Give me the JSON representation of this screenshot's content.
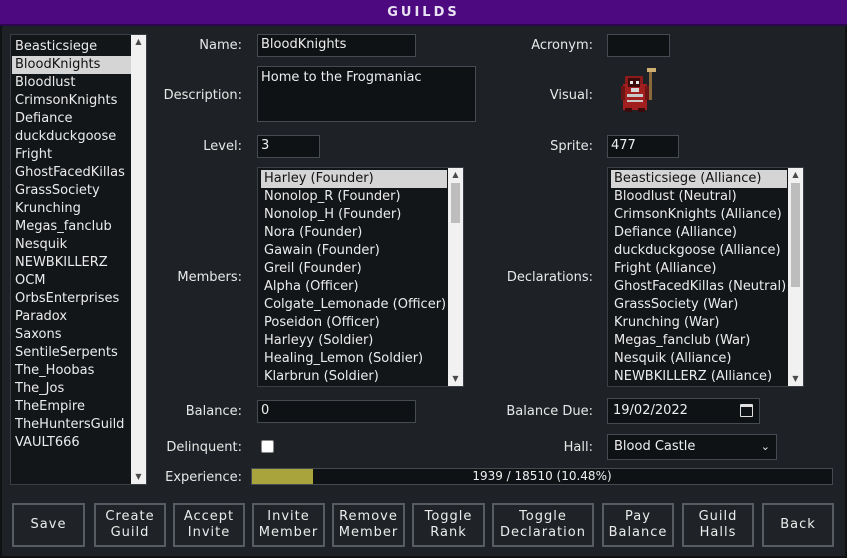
{
  "window": {
    "title": "GUILDS"
  },
  "guild_list": {
    "items": [
      "Beasticsiege",
      "BloodKnights",
      "Bloodlust",
      "CrimsonKnights",
      "Defiance",
      "duckduckgoose",
      "Fright",
      "GhostFacedKillas",
      "GrassSociety",
      "Krunching",
      "Megas_fanclub",
      "Nesquik",
      "NEWBKILLERZ",
      "OCM",
      "OrbsEnterprises",
      "Paradox",
      "Saxons",
      "SentileSerpents",
      "The_Hoobas",
      "The_Jos",
      "TheEmpire",
      "TheHuntersGuild",
      "VAULT666"
    ],
    "selected_index": 1
  },
  "form": {
    "name_label": "Name:",
    "name_value": "BloodKnights",
    "acronym_label": "Acronym:",
    "acronym_value": "",
    "description_label": "Description:",
    "description_value": "Home to the Frogmaniac",
    "visual_label": "Visual:",
    "level_label": "Level:",
    "level_value": "3",
    "sprite_label": "Sprite:",
    "sprite_value": "477",
    "members_label": "Members:",
    "declarations_label": "Declarations:",
    "balance_label": "Balance:",
    "balance_value": "0",
    "balance_due_label": "Balance Due:",
    "balance_due_value": "19/02/2022",
    "delinquent_label": "Delinquent:",
    "delinquent_checked": false,
    "hall_label": "Hall:",
    "hall_value": "Blood Castle",
    "experience_label": "Experience:",
    "experience_text": "1939 / 18510 (10.48%)",
    "experience_fraction": 0.1048
  },
  "members": {
    "items": [
      "Harley (Founder)",
      "Nonolop_R (Founder)",
      "Nonolop_H (Founder)",
      "Nora (Founder)",
      "Gawain (Founder)",
      "Greil (Founder)",
      "Alpha (Officer)",
      "Colgate_Lemonade (Officer)",
      "Poseidon (Officer)",
      "Harleyy (Soldier)",
      "Healing_Lemon (Soldier)",
      "Klarbrun (Soldier)"
    ],
    "selected_index": 0
  },
  "declarations": {
    "items": [
      "Beasticsiege (Alliance)",
      "Bloodlust (Neutral)",
      "CrimsonKnights (Alliance)",
      "Defiance (Alliance)",
      "duckduckgoose (Alliance)",
      "Fright (Alliance)",
      "GhostFacedKillas (Neutral)",
      "GrassSociety (War)",
      "Krunching (War)",
      "Megas_fanclub (War)",
      "Nesquik (Alliance)",
      "NEWBKILLERZ (Alliance)"
    ],
    "selected_index": 0
  },
  "buttons": {
    "save": "Save",
    "create_guild": "Create\nGuild",
    "accept_invite": "Accept\nInvite",
    "invite_member": "Invite\nMember",
    "remove_member": "Remove\nMember",
    "toggle_rank": "Toggle\nRank",
    "toggle_declaration": "Toggle\nDeclaration",
    "pay_balance": "Pay\nBalance",
    "guild_halls": "Guild\nHalls",
    "back": "Back"
  },
  "colors": {
    "title_bar": "#4d0a80",
    "background": "#1e2226",
    "progress_fill": "#a9a43c",
    "selection": "#d5d5d5"
  },
  "icons": [
    "calendar-icon",
    "chevron-down-icon",
    "scroll-up-arrow-icon",
    "scroll-down-arrow-icon",
    "guild-sprite-icon"
  ]
}
